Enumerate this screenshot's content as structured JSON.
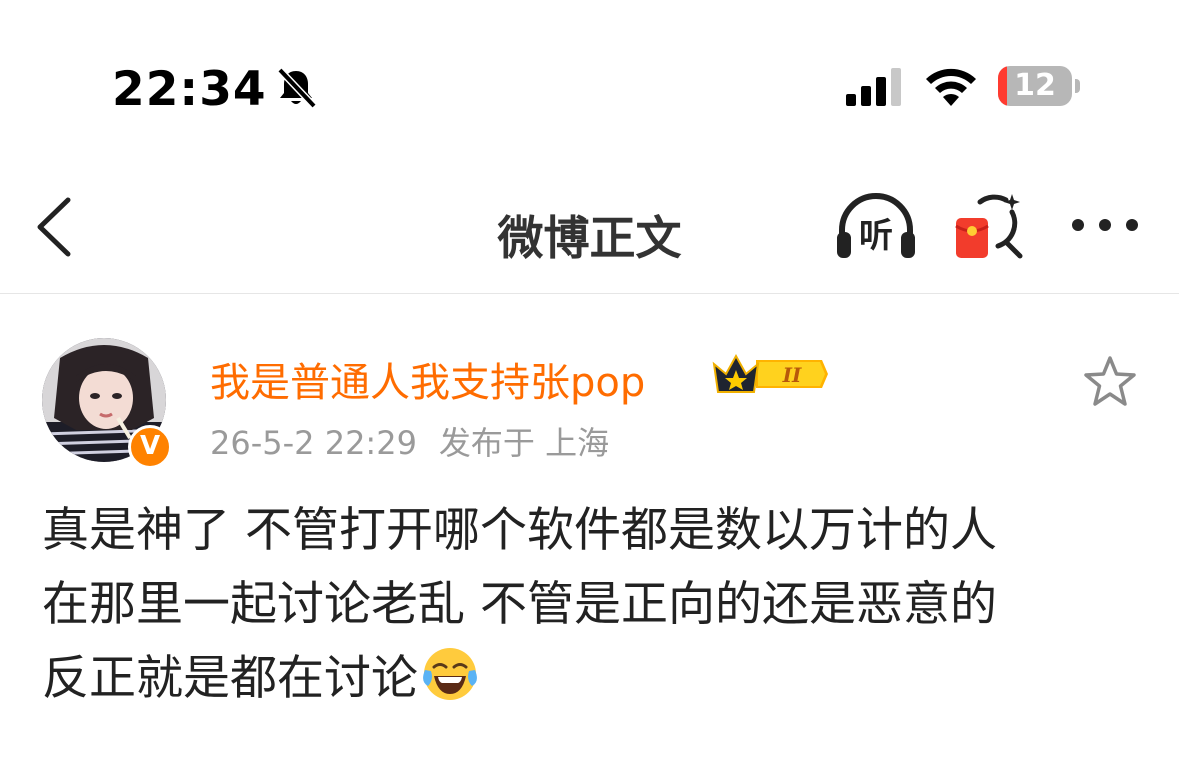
{
  "status_bar": {
    "time": "22:34",
    "battery_level": "12",
    "icons": [
      "bell-off-icon",
      "signal-icon",
      "wifi-icon",
      "battery-icon"
    ]
  },
  "nav": {
    "title": "微博正文",
    "listen_label": "听",
    "icons": [
      "back-icon",
      "headphones-icon",
      "red-packet-icon",
      "more-icon"
    ]
  },
  "post": {
    "username": "我是普通人我支持张pop",
    "vip_level": "II",
    "verified_badge": "V",
    "date": "26-5-2 22:29",
    "location": "发布于 上海",
    "text_lines": [
      "真是神了 不管打开哪个软件都是数以万计的人",
      "在那里一起讨论老乱 不管是正向的还是恶意的",
      "反正就是都在讨论"
    ],
    "emoji": "laughing-crying-emoji"
  },
  "colors": {
    "username": "#ff6c00",
    "meta": "#9a9a9a",
    "battery_low": "#ff3b30",
    "verified": "#ff8200"
  }
}
